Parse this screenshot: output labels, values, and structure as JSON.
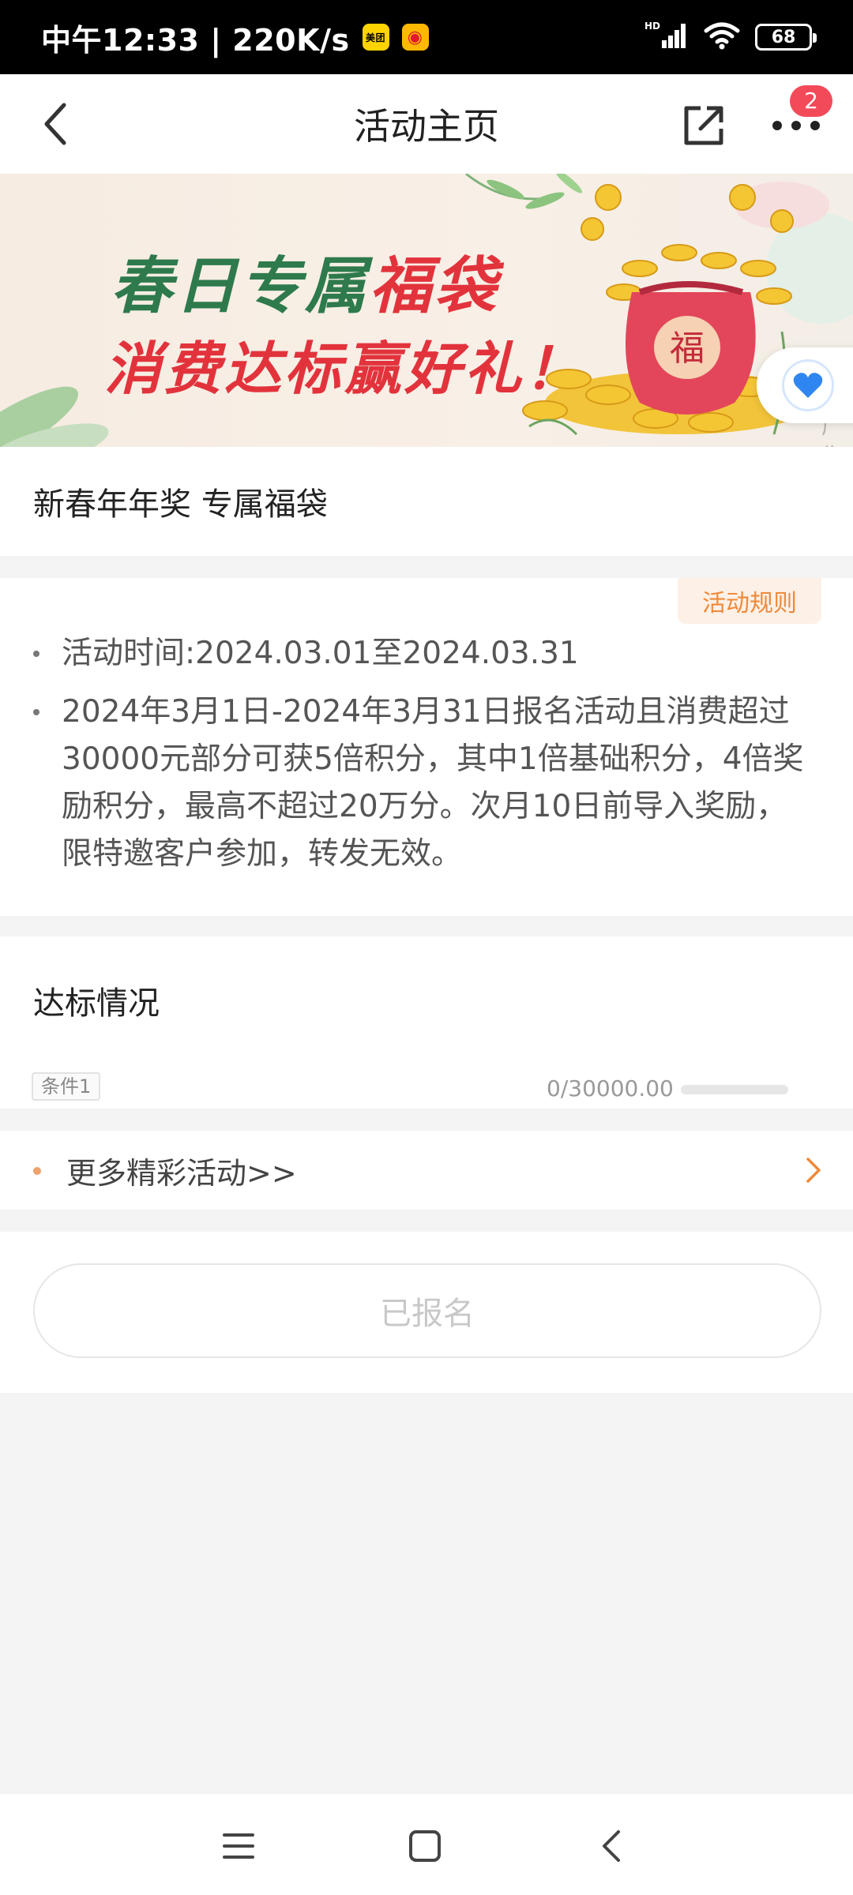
{
  "status_bar": {
    "time_speed": "中午12:33 | 220K/s",
    "app_icon_1": "美团",
    "app_icon_2": "◉",
    "signal_label": "HD",
    "battery": "68"
  },
  "nav": {
    "title": "活动主页",
    "badge_count": "2",
    "back_icon": "chevron-left-icon",
    "share_icon": "share-icon",
    "more_icon": "more-dots-icon"
  },
  "banner": {
    "line1_part1": "春日专属",
    "line1_part2": "福袋",
    "line2": "消费达标赢好礼！",
    "ad_label": "广告",
    "bag_char": "福",
    "colors": {
      "green": "#2e7a4c",
      "red": "#e2333c",
      "gold": "#f5c634"
    }
  },
  "activity": {
    "title": "新春年年奖 专属福袋",
    "rules_button": "活动规则",
    "rule_1": "活动时间:2024.03.01至2024.03.31",
    "rule_2": "2024年3月1日-2024年3月31日报名活动且消费超过30000元部分可获5倍积分，其中1倍基础积分，4倍奖励积分，最高不超过20万分。次月10日前导入奖励，限特邀客户参加，转发无效。"
  },
  "progress": {
    "section_title": "达标情况",
    "condition_tag": "条件1",
    "value_text": "0/30000.00",
    "fraction": 0,
    "accent": "#f28a3a"
  },
  "more": {
    "label": "更多精彩活动>>",
    "chevron_color": "#ee8a3a"
  },
  "register": {
    "button_label": "已报名"
  },
  "system_nav": {
    "menu_icon": "menu-icon",
    "home_icon": "home-square-icon",
    "back_icon": "back-chevron-icon"
  }
}
